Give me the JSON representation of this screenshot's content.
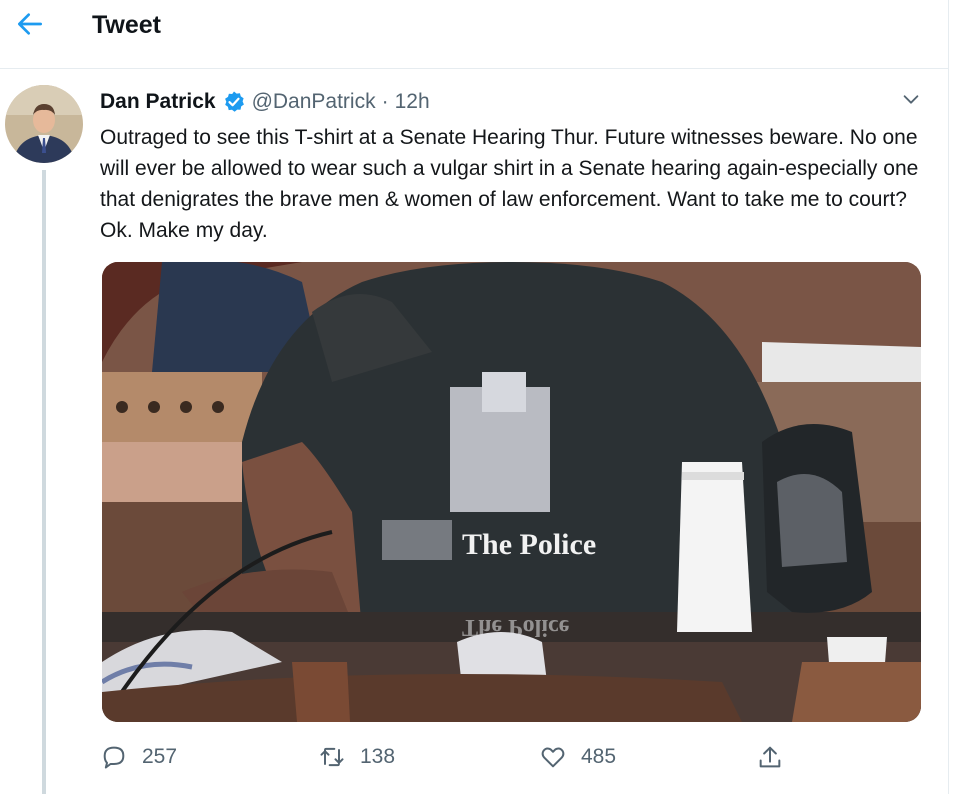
{
  "header": {
    "title": "Tweet",
    "back_icon": "arrow-left-icon"
  },
  "tweet": {
    "author_name": "Dan Patrick",
    "handle": "@DanPatrick",
    "separator": "·",
    "time": "12h",
    "verified": true,
    "text": "Outraged to see this T-shirt at a Senate Hearing Thur.  Future witnesses beware. No one will ever be allowed to wear such a vulgar shirt in a Senate hearing again-especially one that denigrates the brave men & women of law enforcement. Want to take me to court? Ok. Make my day.",
    "photo_shirt_text": "The Police",
    "photo_shirt_text_reflection": "The Police"
  },
  "actions": {
    "reply_count": "257",
    "retweet_count": "138",
    "like_count": "485"
  },
  "colors": {
    "accent": "#1d9bf0",
    "muted": "#536471",
    "border": "#e6ecf0"
  }
}
